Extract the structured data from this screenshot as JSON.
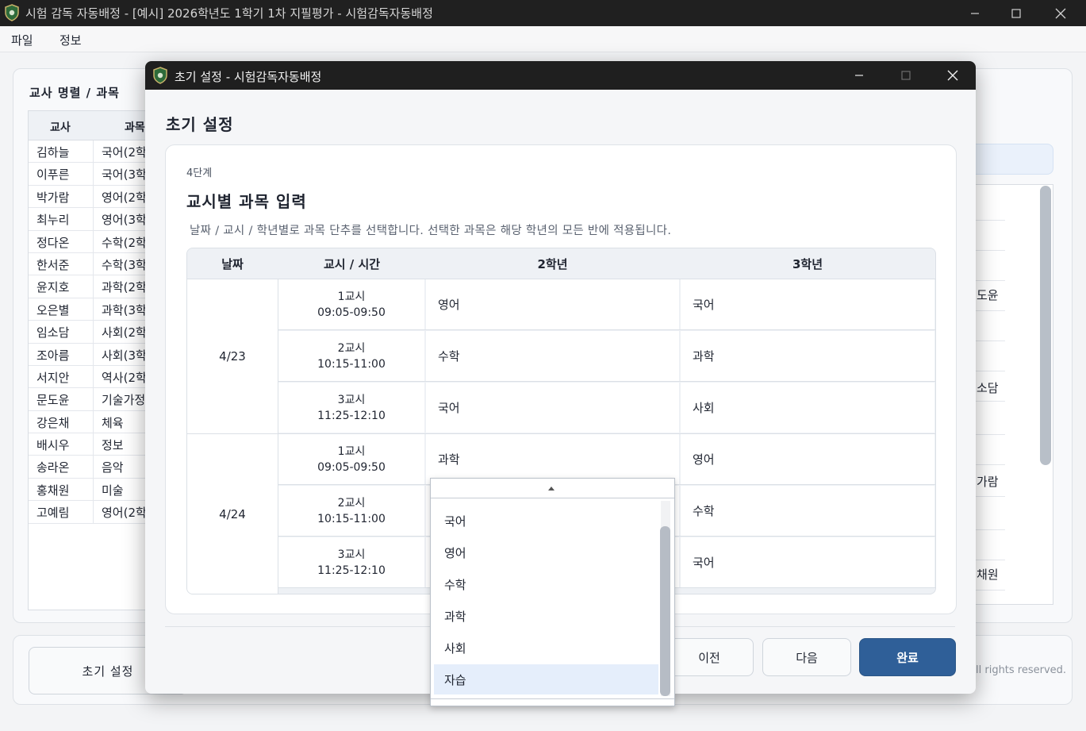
{
  "window": {
    "title": "시험 감독 자동배정 - [예시] 2026학년도 1학기 1차 지필평가 - 시험감독자동배정",
    "menu": [
      "파일",
      "정보"
    ]
  },
  "left_panel": {
    "title": "교사 명렬 / 과목",
    "columns": [
      "교사",
      "과목"
    ],
    "rows": [
      {
        "name": "김하늘",
        "subject": "국어(2학"
      },
      {
        "name": "이푸른",
        "subject": "국어(3학"
      },
      {
        "name": "박가람",
        "subject": "영어(2학"
      },
      {
        "name": "최누리",
        "subject": "영어(3학"
      },
      {
        "name": "정다온",
        "subject": "수학(2학"
      },
      {
        "name": "한서준",
        "subject": "수학(3학"
      },
      {
        "name": "윤지호",
        "subject": "과학(2학"
      },
      {
        "name": "오은별",
        "subject": "과학(3학"
      },
      {
        "name": "임소담",
        "subject": "사회(2학"
      },
      {
        "name": "조아름",
        "subject": "사회(3학"
      },
      {
        "name": "서지안",
        "subject": "역사(2학"
      },
      {
        "name": "문도윤",
        "subject": "기술가정"
      },
      {
        "name": "강은채",
        "subject": "체육"
      },
      {
        "name": "배시우",
        "subject": "정보"
      },
      {
        "name": "송라온",
        "subject": "음악"
      },
      {
        "name": "홍채원",
        "subject": "미술"
      },
      {
        "name": "고예림",
        "subject": "영어(2학"
      }
    ]
  },
  "right_panel": {
    "names": [
      "도윤",
      "소담",
      "가람",
      "채원"
    ]
  },
  "bottom": {
    "init_button": "초기 설정",
    "copyright": "ll rights reserved."
  },
  "dialog": {
    "title": "초기 설정 - 시험감독자동배정",
    "heading": "초기 설정",
    "step": "4단계",
    "card_title": "교시별 과목 입력",
    "description": "날짜 / 교시 / 학년별로 과목 단추를 선택합니다. 선택한 과목은 해당 학년의 모든 반에 적용됩니다.",
    "columns": [
      "날짜",
      "교시 / 시간",
      "2학년",
      "3학년"
    ],
    "dates": [
      "4/23",
      "4/24"
    ],
    "rows": [
      {
        "period": "1교시",
        "time": "09:05-09:50",
        "g2": "영어",
        "g3": "국어"
      },
      {
        "period": "2교시",
        "time": "10:15-11:00",
        "g2": "수학",
        "g3": "과학"
      },
      {
        "period": "3교시",
        "time": "11:25-12:10",
        "g2": "국어",
        "g3": "사회"
      },
      {
        "period": "1교시",
        "time": "09:05-09:50",
        "g2": "과학",
        "g3": "영어"
      },
      {
        "period": "2교시",
        "time": "10:15-11:00",
        "g2": "",
        "g3": "수학"
      },
      {
        "period": "3교시",
        "time": "11:25-12:10",
        "g2": "",
        "g3": "국어"
      }
    ],
    "buttons": {
      "prev": "이전",
      "next": "다음",
      "finish": "완료"
    }
  },
  "dropdown": {
    "options": [
      "국어",
      "영어",
      "수학",
      "과학",
      "사회",
      "자습"
    ],
    "highlighted": "자습"
  },
  "colors": {
    "accent": "#2f5f98",
    "titlebar": "#202020",
    "highlight": "#e5eefb"
  }
}
